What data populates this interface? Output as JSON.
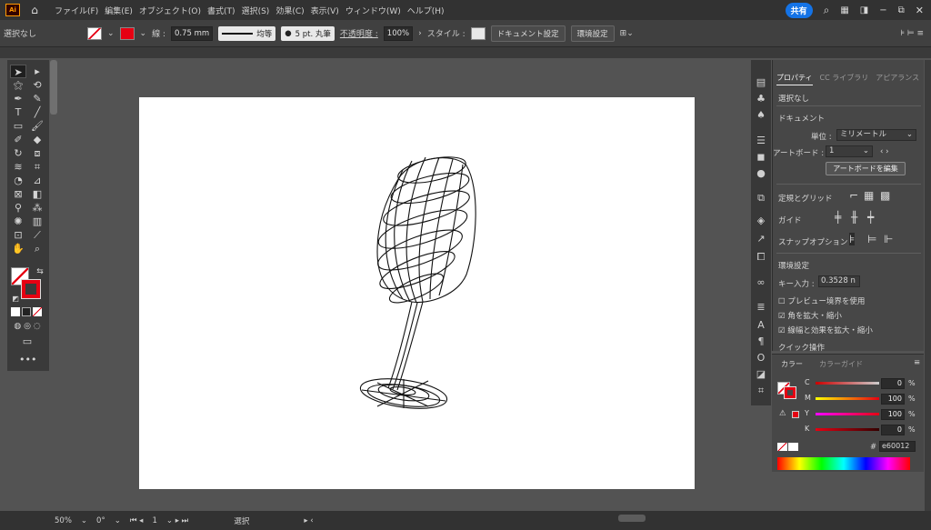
{
  "menubar": {
    "logo": "Ai",
    "menus": [
      "ファイル(F)",
      "編集(E)",
      "オブジェクト(O)",
      "書式(T)",
      "選択(S)",
      "効果(C)",
      "表示(V)",
      "ウィンドウ(W)",
      "ヘルプ(H)"
    ],
    "share_label": "共有"
  },
  "control": {
    "selection_label": "選択なし",
    "stroke_label": "線 :",
    "stroke_weight": "0.75 mm",
    "stroke_profile": "均等",
    "brush": "5 pt. 丸筆",
    "opacity_label": "不透明度 :",
    "opacity_value": "100%",
    "style_label": "スタイル :",
    "doc_setup_button": "ドキュメント設定",
    "prefs_button": "環境設定"
  },
  "properties_panel": {
    "tabs": [
      "プロパティ",
      "CC ライブラリ",
      "アピアランス"
    ],
    "selection_status": "選択なし",
    "document_heading": "ドキュメント",
    "unit_label": "単位 :",
    "unit_value": "ミリメートル",
    "artboard_label": "アートボード :",
    "artboard_value": "1",
    "edit_artboard_button": "アートボードを編集",
    "rulers_grid_label": "定規とグリッド",
    "guides_label": "ガイド",
    "snap_label": "スナップオプション",
    "prefs_heading": "環境設定",
    "key_input_label": "キー入力 :",
    "key_input_value": "0.3528 n",
    "preview_bounds_label": "プレビュー境界を使用",
    "scale_corners_label": "角を拡大・縮小",
    "scale_strokes_label": "線幅と効果を拡大・縮小",
    "quick_actions_label": "クイック操作"
  },
  "color_panel": {
    "tabs": [
      "カラー",
      "カラーガイド"
    ],
    "channels": [
      {
        "letter": "C",
        "value": "0",
        "color": "#e60012"
      },
      {
        "letter": "M",
        "value": "100",
        "color": "#e60012"
      },
      {
        "letter": "Y",
        "value": "100",
        "color": "#e60012"
      },
      {
        "letter": "K",
        "value": "0",
        "color": "#e60012"
      }
    ],
    "percent_sign": "%",
    "hex_value": "e60012"
  },
  "statusbar": {
    "zoom": "50%",
    "rotation": "0°",
    "artboard_number": "1",
    "tool_name": "選択"
  },
  "colors": {
    "stroke_red": "#e60012",
    "canvas_bg": "#535353",
    "artboard_bg": "#ffffff"
  }
}
